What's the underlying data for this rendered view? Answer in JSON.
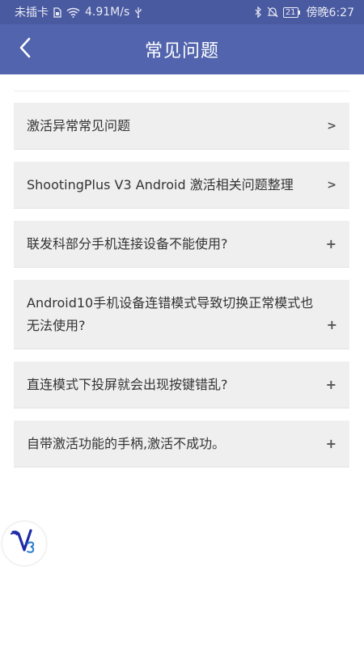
{
  "status_bar": {
    "carrier": "未插卡",
    "speed": "4.91M/s",
    "battery": "21",
    "time": "傍晚6:27"
  },
  "header": {
    "title": "常见问题"
  },
  "faq": {
    "items": [
      {
        "text": "激活异常常见问题",
        "indicator": ">"
      },
      {
        "text": "ShootingPlus V3 Android 激活相关问题整理",
        "indicator": ">"
      },
      {
        "text": "联发科部分手机连接设备不能使用?",
        "indicator": "+"
      },
      {
        "text": "Android10手机设备连错模式导致切换正常模式也无法使用?",
        "indicator": "+"
      },
      {
        "text": "直连模式下投屏就会出现按键错乱?",
        "indicator": "+"
      },
      {
        "text": "自带激活功能的手柄,激活不成功。",
        "indicator": "+"
      }
    ]
  },
  "colors": {
    "status_bar": "#4a5aa0",
    "title_bar": "#5264ad",
    "item_bg": "#efefef"
  },
  "icons": [
    "sim-card-icon",
    "wifi-icon",
    "usb-icon",
    "bluetooth-icon",
    "bell-off-icon",
    "back-arrow-icon",
    "v3-logo-icon"
  ]
}
